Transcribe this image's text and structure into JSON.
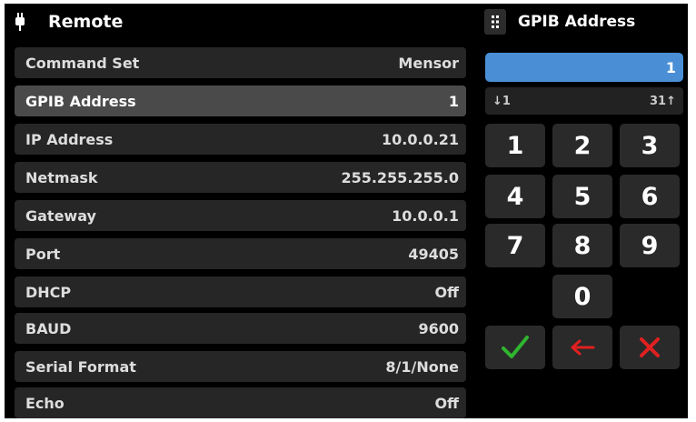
{
  "header": {
    "title": "Remote"
  },
  "keypad": {
    "title": "GPIB Address",
    "entry_value": "1",
    "range_min": "↓1",
    "range_max": "31↑",
    "keys": [
      "1",
      "2",
      "3",
      "4",
      "5",
      "6",
      "7",
      "8",
      "9",
      "0"
    ],
    "icons": {
      "enter": "checkmark-icon",
      "back": "left-arrow-icon",
      "cancel": "x-icon"
    },
    "colors": {
      "entry": "#4a8fd6",
      "enter": "#2fb52f",
      "back": "#e02020",
      "cancel": "#e02020"
    }
  },
  "settings": [
    {
      "label": "Command Set",
      "value": "Mensor"
    },
    {
      "label": "GPIB Address",
      "value": "1"
    },
    {
      "label": "IP Address",
      "value": "10.0.0.21"
    },
    {
      "label": "Netmask",
      "value": "255.255.255.0"
    },
    {
      "label": "Gateway",
      "value": "10.0.0.1"
    },
    {
      "label": "Port",
      "value": "49405"
    },
    {
      "label": "DHCP",
      "value": "Off"
    },
    {
      "label": "BAUD",
      "value": "9600"
    },
    {
      "label": "Serial Format",
      "value": "8/1/None"
    },
    {
      "label": "Echo",
      "value": "Off"
    }
  ]
}
